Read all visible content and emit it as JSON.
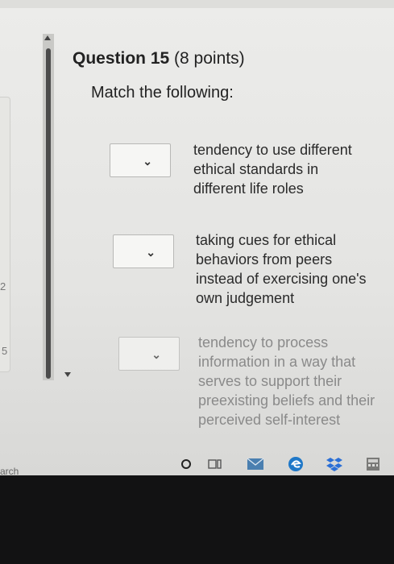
{
  "question": {
    "title_bold": "Question 15",
    "points": "(8 points)",
    "instruction": "Match the following:"
  },
  "items": [
    {
      "select_value": "",
      "text_lines": [
        "tendency to use different",
        "ethical standards in",
        "different life roles"
      ]
    },
    {
      "select_value": "",
      "text_lines": [
        "taking cues for ethical",
        "behaviors from peers",
        "instead of exercising one's",
        "own judgement"
      ]
    },
    {
      "select_value": "",
      "text_lines": [
        "tendency to process",
        "information in a way that",
        "serves to support their",
        "preexisting beliefs and their",
        "perceived self-interest"
      ]
    }
  ],
  "left_panel": {
    "numbers": [
      "2",
      "5"
    ]
  },
  "search": {
    "label": "arch"
  },
  "taskbar": {
    "icons": [
      "cortana-circle-icon",
      "task-view-icon",
      "mail-icon",
      "edge-browser-icon",
      "dropbox-icon",
      "calculator-icon"
    ]
  },
  "colors": {
    "text": "#222222",
    "faded_text": "#8a8a8a",
    "bezel": "#121213",
    "mail": "#4a7fb0",
    "edge": "#1f78c8",
    "dropbox": "#2b6fd6"
  }
}
